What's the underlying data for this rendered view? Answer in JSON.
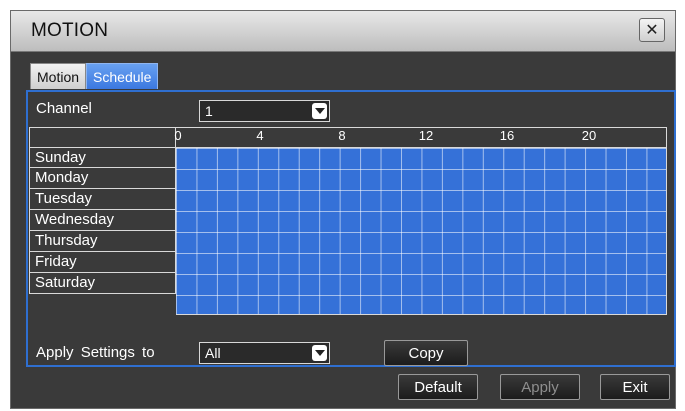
{
  "window": {
    "title": "MOTION",
    "close_symbol": "✕"
  },
  "tabs": [
    {
      "label": "Motion",
      "active": false
    },
    {
      "label": "Schedule",
      "active": true
    }
  ],
  "channel": {
    "label": "Channel",
    "value": "1"
  },
  "schedule": {
    "hour_ticks": [
      "0",
      "4",
      "8",
      "12",
      "16",
      "20"
    ],
    "days": [
      "Sunday",
      "Monday",
      "Tuesday",
      "Wednesday",
      "Thursday",
      "Friday",
      "Saturday"
    ],
    "cell_color": "#3571d8",
    "hours_per_day": 24,
    "all_selected": true
  },
  "apply_settings": {
    "label": "Apply Settings to",
    "value": "All",
    "copy_label": "Copy"
  },
  "footer": {
    "default_label": "Default",
    "apply_label": "Apply",
    "exit_label": "Exit"
  },
  "colors": {
    "accent": "#3b78e0",
    "panel_border": "#2f6fd0",
    "background": "#3a3a3a"
  }
}
